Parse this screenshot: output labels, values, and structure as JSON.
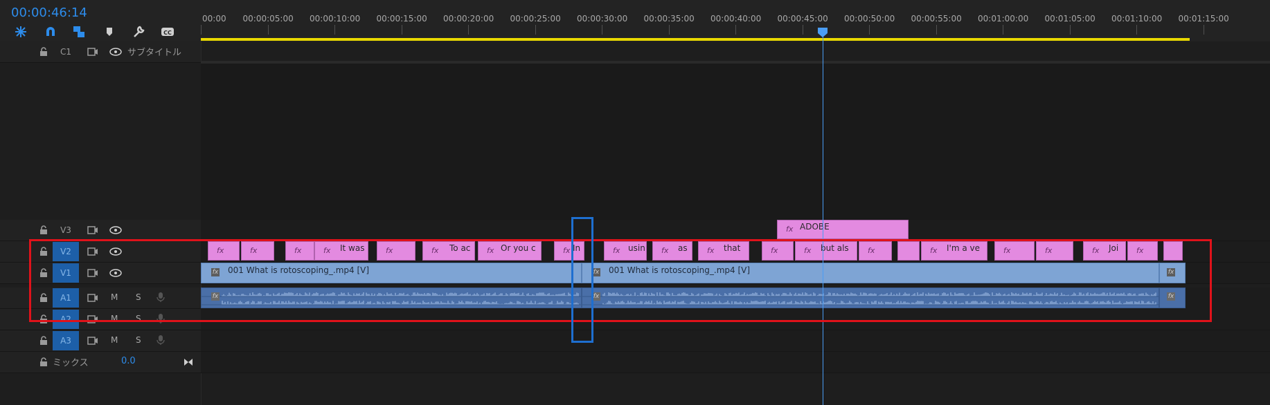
{
  "timecode": "00:00:46:14",
  "colors": {
    "accent": "#2d8ceb",
    "clip_pink": "#e38ae0",
    "clip_video": "#7ea4d4",
    "clip_audio": "#4a6fa8",
    "in_out_bar": "#e8d800",
    "highlight_red": "#e0121a",
    "highlight_blue": "#1e6fd0"
  },
  "toolbar": {
    "tools": [
      "insert-nest-icon",
      "snap-magnet-icon",
      "linked-selection-icon",
      "add-marker-icon",
      "timeline-settings-wrench-icon",
      "captions-cc-icon"
    ]
  },
  "ruler": {
    "ticks": [
      "00:00",
      "00:00:05:00",
      "00:00:10:00",
      "00:00:15:00",
      "00:00:20:00",
      "00:00:25:00",
      "00:00:30:00",
      "00:00:35:00",
      "00:00:40:00",
      "00:00:45:00",
      "00:00:50:00",
      "00:00:55:00",
      "00:01:00:00",
      "00:01:05:00",
      "00:01:10:00",
      "00:01:15:00"
    ]
  },
  "tracks": {
    "c1": {
      "label": "C1",
      "name": "サブタイトル"
    },
    "v3": {
      "label": "V3"
    },
    "v2": {
      "label": "V2"
    },
    "v1": {
      "label": "V1"
    },
    "a1": {
      "label": "A1",
      "mute": "M",
      "solo": "S"
    },
    "a2": {
      "label": "A2",
      "mute": "M",
      "solo": "S"
    },
    "a3": {
      "label": "A3",
      "mute": "M",
      "solo": "S"
    },
    "mix": {
      "label": "ミックス",
      "value": "0.0"
    }
  },
  "clips": {
    "v3": [
      {
        "text": "ADOBE"
      }
    ],
    "v2": [
      {
        "text": ""
      },
      {
        "text": ""
      },
      {
        "text": ""
      },
      {
        "text": "It was"
      },
      {
        "text": ""
      },
      {
        "text": "To ac"
      },
      {
        "text": "Or you c"
      },
      {
        "text": "In"
      },
      {
        "text": "usin"
      },
      {
        "text": "as"
      },
      {
        "text": "that"
      },
      {
        "text": ""
      },
      {
        "text": "but als"
      },
      {
        "text": ""
      },
      {
        "text": ""
      },
      {
        "text": "I'm a ve"
      },
      {
        "text": ""
      },
      {
        "text": ""
      },
      {
        "text": "Joi"
      },
      {
        "text": ""
      },
      {
        "text": ""
      }
    ],
    "v1": [
      {
        "text": "001 What is rotoscoping_.mp4 [V]"
      },
      {
        "text": "001 What is rotoscoping_.mp4 [V]"
      },
      {
        "text": ""
      }
    ]
  }
}
